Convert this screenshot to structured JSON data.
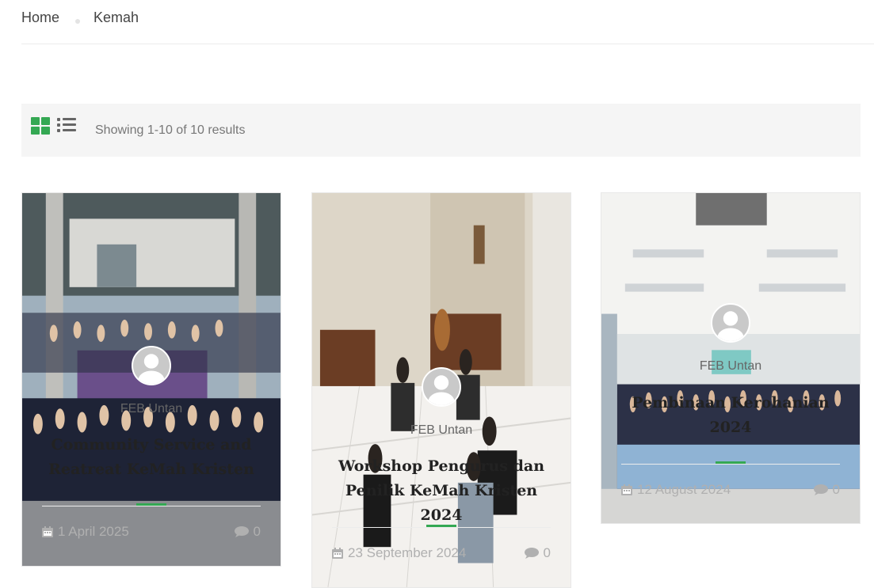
{
  "breadcrumb": {
    "home": "Home",
    "current": "Kemah"
  },
  "toolbar": {
    "results_text": "Showing 1-10 of 10 results",
    "grid_view_icon": "grid-icon",
    "list_view_icon": "list-icon"
  },
  "colors": {
    "accent": "#34a853",
    "muted": "#b0b0b0",
    "toolbar_bg": "#f5f5f5"
  },
  "posts": [
    {
      "author": "FEB Untan",
      "title": "Community Service and Reatreat KeMah Kristen",
      "date": "1 April 2025",
      "comments": "0"
    },
    {
      "author": "FEB Untan",
      "title": "Workshop Pengurus dan Penilik KeMah Kristen 2024",
      "date": "23 September 2024",
      "comments": "0"
    },
    {
      "author": "FEB Untan",
      "title": "Pembinaan Kerohanian 2024",
      "date": "12 August 2024",
      "comments": "0"
    }
  ]
}
